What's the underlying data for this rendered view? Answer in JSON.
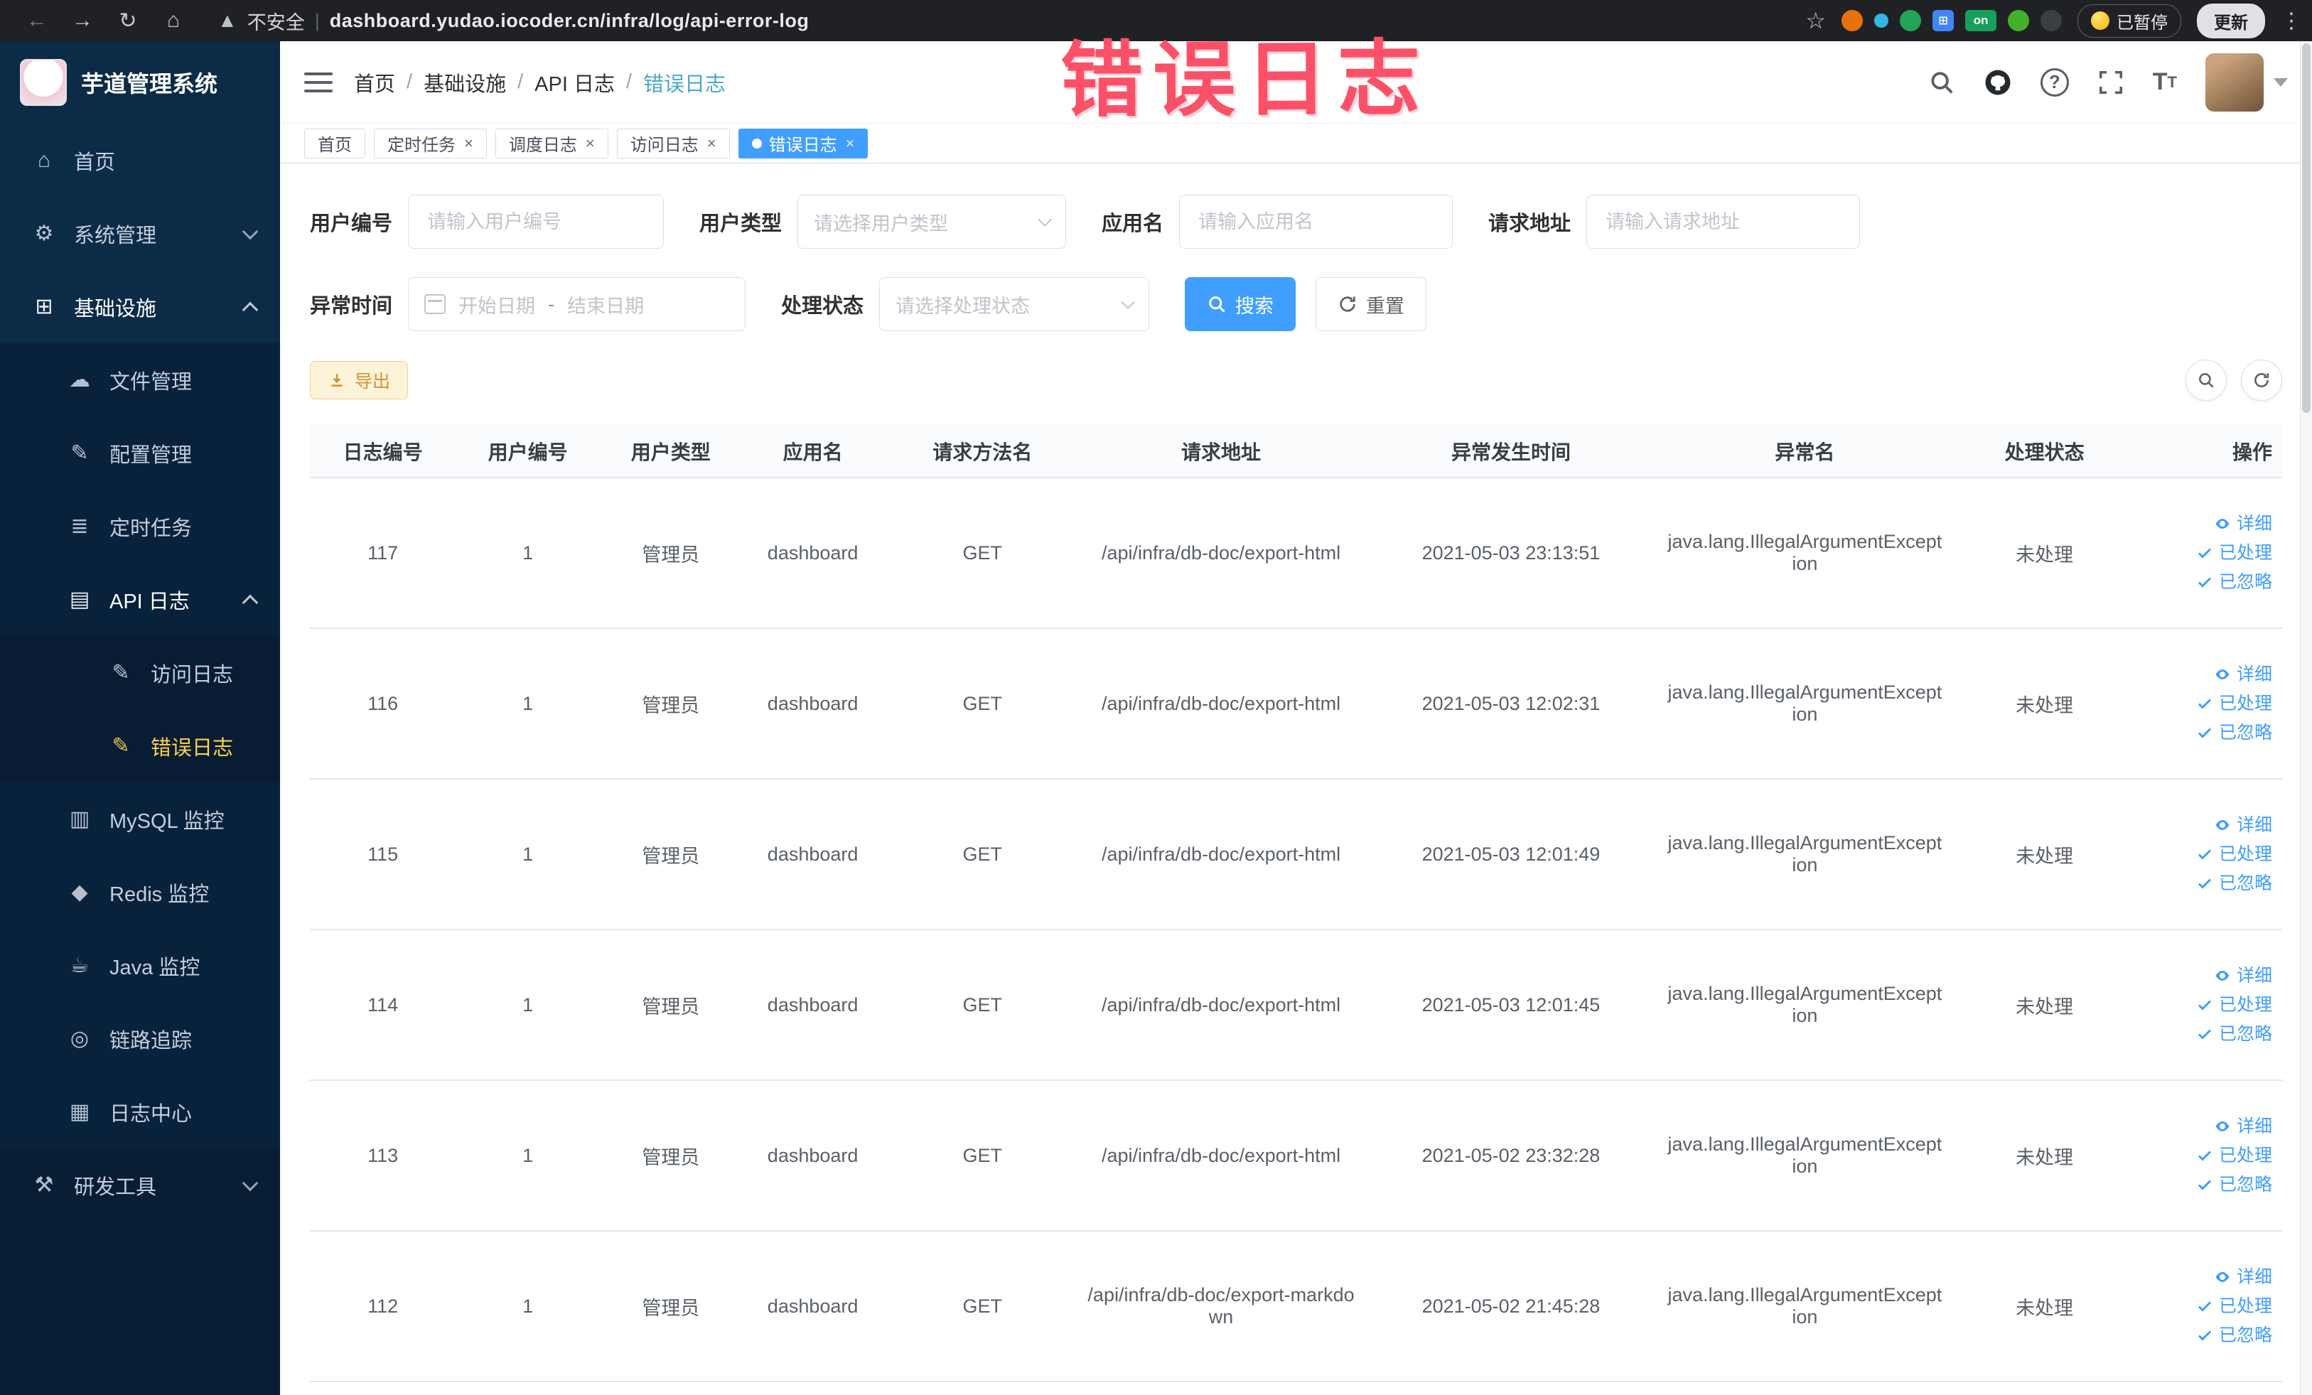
{
  "annotation": {
    "text": "错误日志"
  },
  "browser": {
    "security_label": "不安全",
    "url": "dashboard.yudao.iocoder.cn/infra/log/api-error-log",
    "paused_badge": "已暂停",
    "update_button": "更新",
    "extension_on_badge": "on",
    "extension_colors": [
      "#e8710a",
      "#35b5e5",
      "#23a559",
      "#4285f4",
      "#16a05d",
      "#43b02a",
      "#3a3f44"
    ]
  },
  "sidebar": {
    "logo_title": "芋道管理系统",
    "items": [
      {
        "label": "首页",
        "icon": "home-icon",
        "level": 1
      },
      {
        "label": "系统管理",
        "icon": "gear-icon",
        "level": 1,
        "arrow": "down"
      },
      {
        "label": "基础设施",
        "icon": "infra-icon",
        "level": 1,
        "arrow": "up",
        "expanded": true
      },
      {
        "label": "文件管理",
        "icon": "file-icon",
        "level": 2
      },
      {
        "label": "配置管理",
        "icon": "config-icon",
        "level": 2
      },
      {
        "label": "定时任务",
        "icon": "schedule-icon",
        "level": 2
      },
      {
        "label": "API 日志",
        "icon": "api-log-icon",
        "level": 2,
        "arrow": "up",
        "expanded": true
      },
      {
        "label": "访问日志",
        "icon": "access-log-icon",
        "level": 3
      },
      {
        "label": "错误日志",
        "icon": "error-log-icon",
        "level": 3,
        "active": true
      },
      {
        "label": "MySQL 监控",
        "icon": "mysql-icon",
        "level": 2
      },
      {
        "label": "Redis 监控",
        "icon": "redis-icon",
        "level": 2
      },
      {
        "label": "Java 监控",
        "icon": "java-icon",
        "level": 2
      },
      {
        "label": "链路追踪",
        "icon": "trace-icon",
        "level": 2
      },
      {
        "label": "日志中心",
        "icon": "log-center-icon",
        "level": 2
      },
      {
        "label": "研发工具",
        "icon": "tools-icon",
        "level": 1,
        "arrow": "down",
        "section": "bottom"
      }
    ]
  },
  "navbar": {
    "breadcrumb": [
      "首页",
      "基础设施",
      "API 日志",
      "错误日志"
    ]
  },
  "tabs": [
    {
      "label": "首页",
      "closable": false,
      "active": false
    },
    {
      "label": "定时任务",
      "closable": true,
      "active": false
    },
    {
      "label": "调度日志",
      "closable": true,
      "active": false
    },
    {
      "label": "访问日志",
      "closable": true,
      "active": false
    },
    {
      "label": "错误日志",
      "closable": true,
      "active": true
    }
  ],
  "filters": {
    "user_id_label": "用户编号",
    "user_id_placeholder": "请输入用户编号",
    "user_type_label": "用户类型",
    "user_type_placeholder": "请选择用户类型",
    "app_name_label": "应用名",
    "app_name_placeholder": "请输入应用名",
    "request_url_label": "请求地址",
    "request_url_placeholder": "请输入请求地址",
    "exception_time_label": "异常时间",
    "date_start_placeholder": "开始日期",
    "date_separator": "-",
    "date_end_placeholder": "结束日期",
    "process_status_label": "处理状态",
    "process_status_placeholder": "请选择处理状态",
    "search_button": "搜索",
    "reset_button": "重置"
  },
  "toolbar": {
    "export_button": "导出"
  },
  "table": {
    "headers": [
      "日志编号",
      "用户编号",
      "用户类型",
      "应用名",
      "请求方法名",
      "请求地址",
      "异常发生时间",
      "异常名",
      "处理状态",
      "操作"
    ],
    "actions": [
      "详细",
      "已处理",
      "已忽略"
    ],
    "rows": [
      {
        "id": "117",
        "user_id": "1",
        "user_type": "管理员",
        "app": "dashboard",
        "method": "GET",
        "url": "/api/infra/db-doc/export-html",
        "time": "2021-05-03 23:13:51",
        "exception": "java.lang.IllegalArgumentException",
        "status": "未处理"
      },
      {
        "id": "116",
        "user_id": "1",
        "user_type": "管理员",
        "app": "dashboard",
        "method": "GET",
        "url": "/api/infra/db-doc/export-html",
        "time": "2021-05-03 12:02:31",
        "exception": "java.lang.IllegalArgumentException",
        "status": "未处理"
      },
      {
        "id": "115",
        "user_id": "1",
        "user_type": "管理员",
        "app": "dashboard",
        "method": "GET",
        "url": "/api/infra/db-doc/export-html",
        "time": "2021-05-03 12:01:49",
        "exception": "java.lang.IllegalArgumentException",
        "status": "未处理"
      },
      {
        "id": "114",
        "user_id": "1",
        "user_type": "管理员",
        "app": "dashboard",
        "method": "GET",
        "url": "/api/infra/db-doc/export-html",
        "time": "2021-05-03 12:01:45",
        "exception": "java.lang.IllegalArgumentException",
        "status": "未处理"
      },
      {
        "id": "113",
        "user_id": "1",
        "user_type": "管理员",
        "app": "dashboard",
        "method": "GET",
        "url": "/api/infra/db-doc/export-html",
        "time": "2021-05-02 23:32:28",
        "exception": "java.lang.IllegalArgumentException",
        "status": "未处理"
      },
      {
        "id": "112",
        "user_id": "1",
        "user_type": "管理员",
        "app": "dashboard",
        "method": "GET",
        "url": "/api/infra/db-doc/export-markdown",
        "time": "2021-05-02 21:45:28",
        "exception": "java.lang.IllegalArgumentException",
        "status": "未处理"
      }
    ]
  }
}
